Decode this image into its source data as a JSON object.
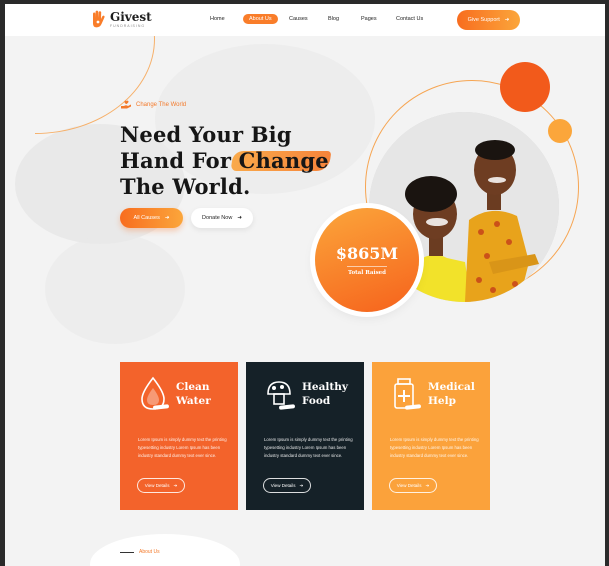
{
  "brand": {
    "name": "Givest",
    "tagline": "FUNDRAISING"
  },
  "nav": {
    "items": [
      "Home",
      "About Us",
      "Causes",
      "Blog",
      "Pages",
      "Contact Us"
    ],
    "active": "About Us"
  },
  "header": {
    "support_button": "Give Support"
  },
  "hero": {
    "eyebrow": "Change The World",
    "title_line1": "Need Your Big",
    "title_line2_a": "Hand For ",
    "title_line2_b": "Change",
    "title_line3": "The World.",
    "primary_button": "All Causes",
    "secondary_button": "Donate Now",
    "stat_value": "$865M",
    "stat_label": "Total Raised"
  },
  "cards": [
    {
      "title_line1": "Clean",
      "title_line2": "Water",
      "icon": "water-drop-icon",
      "text": "Lorem Ipsum is simply dummy text the printing typesetting industry Lorem Ipsum has been industry standard dummy text ever since.",
      "button": "View Details",
      "color": "#f3632b"
    },
    {
      "title_line1": "Healthy",
      "title_line2": "Food",
      "icon": "food-icon",
      "text": "Lorem Ipsum is simply dummy text the printing typesetting industry Lorem Ipsum has been industry standard dummy text ever since.",
      "button": "View Details",
      "color": "#152128"
    },
    {
      "title_line1": "Medical",
      "title_line2": "Help",
      "icon": "medical-kit-icon",
      "text": "Lorem Ipsum is simply dummy text the printing typesetting industry Lorem Ipsum has been industry standard dummy text ever since.",
      "button": "View Details",
      "color": "#fba23b"
    }
  ],
  "about": {
    "eyebrow": "About Us"
  },
  "colors": {
    "accent": "#f97d2a",
    "dark": "#152128",
    "light_orange": "#fba23b"
  }
}
